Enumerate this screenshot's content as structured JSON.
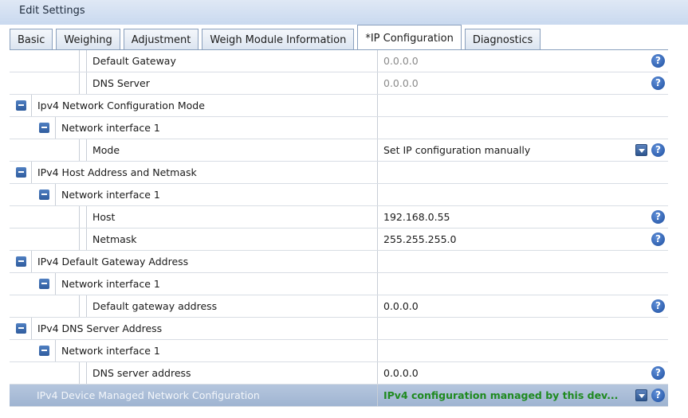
{
  "window": {
    "title": "Edit Settings"
  },
  "tabs": [
    {
      "label": "Basic",
      "active": false
    },
    {
      "label": "Weighing",
      "active": false
    },
    {
      "label": "Adjustment",
      "active": false
    },
    {
      "label": "Weigh Module Information",
      "active": false
    },
    {
      "label": "*IP Configuration",
      "active": true
    },
    {
      "label": "Diagnostics",
      "active": false
    }
  ],
  "rows": [
    {
      "level": 3,
      "name": "Default Gateway",
      "value": "0.0.0.0",
      "value_style": "gray",
      "help": true
    },
    {
      "level": 3,
      "name": "DNS Server",
      "value": "0.0.0.0",
      "value_style": "gray",
      "help": true
    },
    {
      "level": 1,
      "name": "Ipv4 Network Configuration Mode",
      "value": "",
      "expander": true
    },
    {
      "level": 2,
      "name": "Network interface 1",
      "value": "",
      "expander": true
    },
    {
      "level": 3,
      "name": "Mode",
      "value": "Set IP configuration manually",
      "dropdown": true,
      "help": true
    },
    {
      "level": 1,
      "name": "IPv4 Host Address and Netmask",
      "value": "",
      "expander": true
    },
    {
      "level": 2,
      "name": "Network interface 1",
      "value": "",
      "expander": true
    },
    {
      "level": 3,
      "name": "Host",
      "value": "192.168.0.55",
      "help": true
    },
    {
      "level": 3,
      "name": "Netmask",
      "value": "255.255.255.0",
      "help": true
    },
    {
      "level": 1,
      "name": "IPv4 Default Gateway Address",
      "value": "",
      "expander": true
    },
    {
      "level": 2,
      "name": "Network interface 1",
      "value": "",
      "expander": true
    },
    {
      "level": 3,
      "name": "Default gateway address",
      "value": "0.0.0.0",
      "help": true
    },
    {
      "level": 1,
      "name": "IPv4 DNS Server Address",
      "value": "",
      "expander": true
    },
    {
      "level": 2,
      "name": "Network interface 1",
      "value": "",
      "expander": true
    },
    {
      "level": 3,
      "name": "DNS server address",
      "value": "0.0.0.0",
      "help": true
    },
    {
      "level": 1,
      "name": "IPv4 Device Managed Network Configuration",
      "value": "IPv4 configuration managed by this dev...",
      "selected": true,
      "dropdown": true,
      "help": true
    }
  ],
  "icons": {
    "expander": "minus-box-icon",
    "help": "question-mark-icon",
    "dropdown": "dropdown-arrow-icon",
    "help_glyph": "?"
  },
  "colors": {
    "title_bg": "#c9d9ef",
    "selected_row": "#9fb4d1",
    "managed_value": "#1f8a1f",
    "help_icon": "#1e4fa0"
  }
}
